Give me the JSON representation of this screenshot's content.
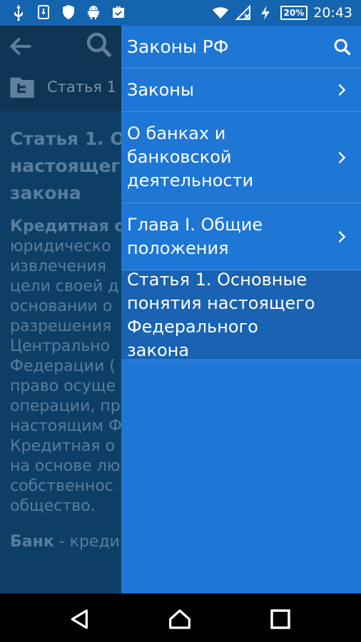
{
  "status_bar": {
    "left_icons": [
      "usb-icon",
      "download-icon",
      "shield-icon",
      "android-icon",
      "briefcase-check-icon"
    ],
    "battery": "20%",
    "time": "20:43"
  },
  "background": {
    "breadcrumb": "Статья 1",
    "title_lines": [
      "Статья 1. О",
      "настоящег",
      "закона"
    ],
    "paragraph1_bold": "Кредитная о",
    "paragraph1_lines": [
      "юридическо",
      "извлечения",
      "цели своей д",
      "основании о",
      "разрешения",
      "Центрально",
      "Федерации (",
      "право осуще",
      "операции, пр",
      "настоящим Ф",
      "Кредитная о",
      "на основе лю",
      "собственнос",
      "общество."
    ],
    "paragraph2_bold": "Банк",
    "paragraph2_text": " - креди"
  },
  "drawer": {
    "title": "Законы РФ",
    "items": [
      {
        "label": "Законы"
      },
      {
        "label": "О банках и банковской деятельности"
      },
      {
        "label": "Глава I. Общие положения"
      },
      {
        "label": "Статья 1. Основные понятия настоящего Федерального закона"
      }
    ]
  },
  "nav_bar": {
    "buttons": [
      "back-triangle-icon",
      "home-icon",
      "recents-icon"
    ]
  },
  "colors": {
    "drawer_bg": "#1e76d5",
    "drawer_active": "#1a62b2",
    "status_bar": "#1564b0",
    "dim_content": "#0d3f66"
  }
}
